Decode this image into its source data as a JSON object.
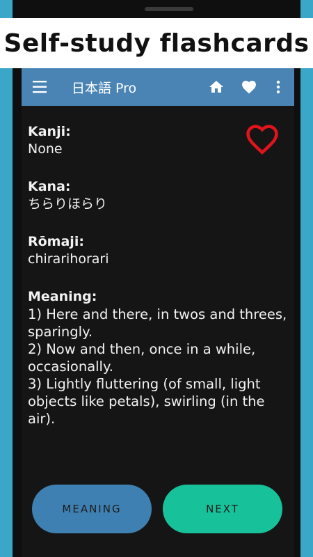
{
  "banner": {
    "text": "Self-study flashcards"
  },
  "appbar": {
    "title": "日本語 Pro",
    "icons": [
      "menu-icon",
      "home-icon",
      "heart-icon",
      "more-vert-icon"
    ]
  },
  "card": {
    "kanji_label": "Kanji:",
    "kanji_value": "None",
    "kana_label": "Kana:",
    "kana_value": "ちらりほらり",
    "romaji_label": "Rōmaji:",
    "romaji_value": "chirarihorari",
    "meaning_label": "Meaning:",
    "meaning_value": "1) Here and there, in twos and threes, sparingly.\n2) Now and then, once in a while, occasionally.\n3) Lightly fluttering (of small, light objects like petals), swirling (in the air).",
    "favorite_icon": "heart-outline-icon"
  },
  "buttons": {
    "meaning": "MEANING",
    "next": "NEXT"
  },
  "colors": {
    "background": "#3aa6c8",
    "appbar": "#4a84b5",
    "meaning_button": "#3f80b2",
    "next_button": "#17c29b",
    "favorite": "#e0141c"
  }
}
